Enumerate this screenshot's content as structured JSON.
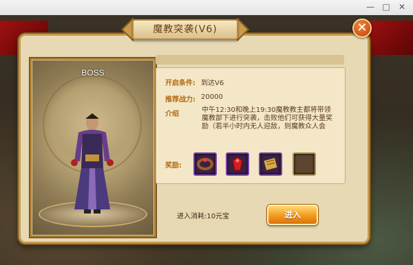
{
  "dialog": {
    "title": "魔教突袭(V6)",
    "close_icon": "close-icon"
  },
  "boss": {
    "label": "BOSS"
  },
  "info": {
    "condition_label": "开启条件:",
    "condition_value": "到达V6",
    "power_label": "推荐战力:",
    "power_value": "20000",
    "intro_label": "介绍",
    "intro_text": "中午12:30和晚上19:30魔教教主都将带领魔教部下进行突袭，击败他们可获得大量奖励（若半小时内无人迎敌，则魔教众人会",
    "reward_label": "奖励:",
    "rewards": [
      {
        "icon": "bracelet-icon"
      },
      {
        "icon": "red-gem-icon"
      },
      {
        "icon": "scroll-icon"
      },
      {
        "icon": "empty-slot"
      }
    ]
  },
  "footer": {
    "cost_text": "进入消耗:10元宝",
    "enter_label": "进入"
  },
  "colors": {
    "panel_bg": "#e8d9b5",
    "accent_orange": "#f39a1d",
    "label_color": "#b26a12",
    "reward_border": "#7a3fb0"
  }
}
